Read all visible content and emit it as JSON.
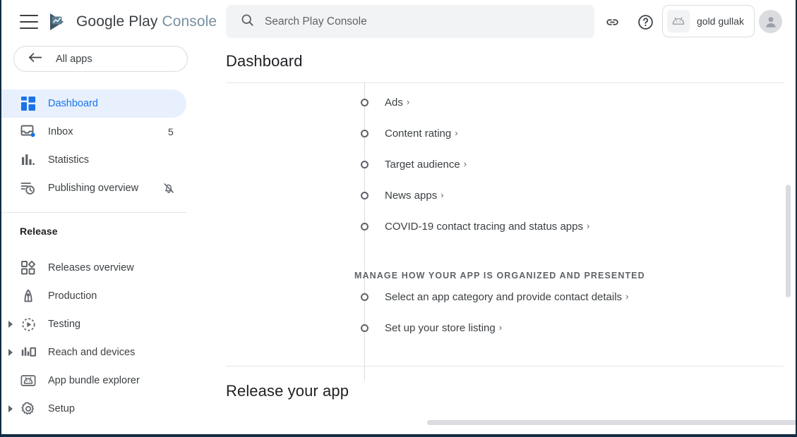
{
  "brand": {
    "google_text": "Google Play",
    "console_text": "Console",
    "logo_icon": "play-console-logo",
    "menu_icon": "hamburger-menu-icon"
  },
  "search": {
    "placeholder": "Search Play Console",
    "value": "",
    "icon": "search-icon"
  },
  "topbar": {
    "link_icon": "link-icon",
    "help_icon": "help-circle-icon",
    "account_name": "gold gullak",
    "account_app_icon": "android-robot-icon",
    "avatar_icon": "user-avatar-icon"
  },
  "sidebar": {
    "all_apps_label": "All apps",
    "all_apps_icon": "arrow-back-icon",
    "items": [
      {
        "label": "Dashboard",
        "icon": "dashboard-grid-icon",
        "active": true,
        "badge": "",
        "expandable": false
      },
      {
        "label": "Inbox",
        "icon": "inbox-icon",
        "active": false,
        "badge": "5",
        "expandable": false
      },
      {
        "label": "Statistics",
        "icon": "bar-chart-icon",
        "active": false,
        "badge": "",
        "expandable": false
      },
      {
        "label": "Publishing overview",
        "icon": "publishing-clock-icon",
        "active": false,
        "badge": "",
        "trailing_icon": "notifications-off-icon",
        "expandable": false
      }
    ],
    "section_heading": "Release",
    "release_items": [
      {
        "label": "Releases overview",
        "icon": "releases-overview-icon",
        "expandable": false
      },
      {
        "label": "Production",
        "icon": "production-rocket-icon",
        "expandable": false
      },
      {
        "label": "Testing",
        "icon": "testing-play-dashed-icon",
        "expandable": true
      },
      {
        "label": "Reach and devices",
        "icon": "reach-devices-icon",
        "expandable": true
      },
      {
        "label": "App bundle explorer",
        "icon": "app-bundle-android-icon",
        "expandable": false
      },
      {
        "label": "Setup",
        "icon": "gear-icon",
        "expandable": true
      }
    ]
  },
  "main": {
    "page_title": "Dashboard",
    "checklist_top": [
      {
        "label": "Ads",
        "chevron": "›"
      },
      {
        "label": "Content rating",
        "chevron": "›"
      },
      {
        "label": "Target audience",
        "chevron": "›"
      },
      {
        "label": "News apps",
        "chevron": "›"
      },
      {
        "label": "COVID-19 contact tracing and status apps",
        "chevron": "›"
      }
    ],
    "section_heading": "MANAGE HOW YOUR APP IS ORGANIZED AND PRESENTED",
    "checklist_bottom": [
      {
        "label": "Select an app category and provide contact details",
        "chevron": "›"
      },
      {
        "label": "Set up your store listing",
        "chevron": "›"
      }
    ],
    "release_app_heading": "Release your app"
  },
  "colors": {
    "accent_blue": "#1a73e8",
    "active_pill": "#e8f0fe",
    "text_primary": "#3c4043",
    "text_secondary": "#5f6368",
    "divider": "#e4e6e8",
    "scrollbar": "#dadce0",
    "window_border": "#132c44"
  }
}
